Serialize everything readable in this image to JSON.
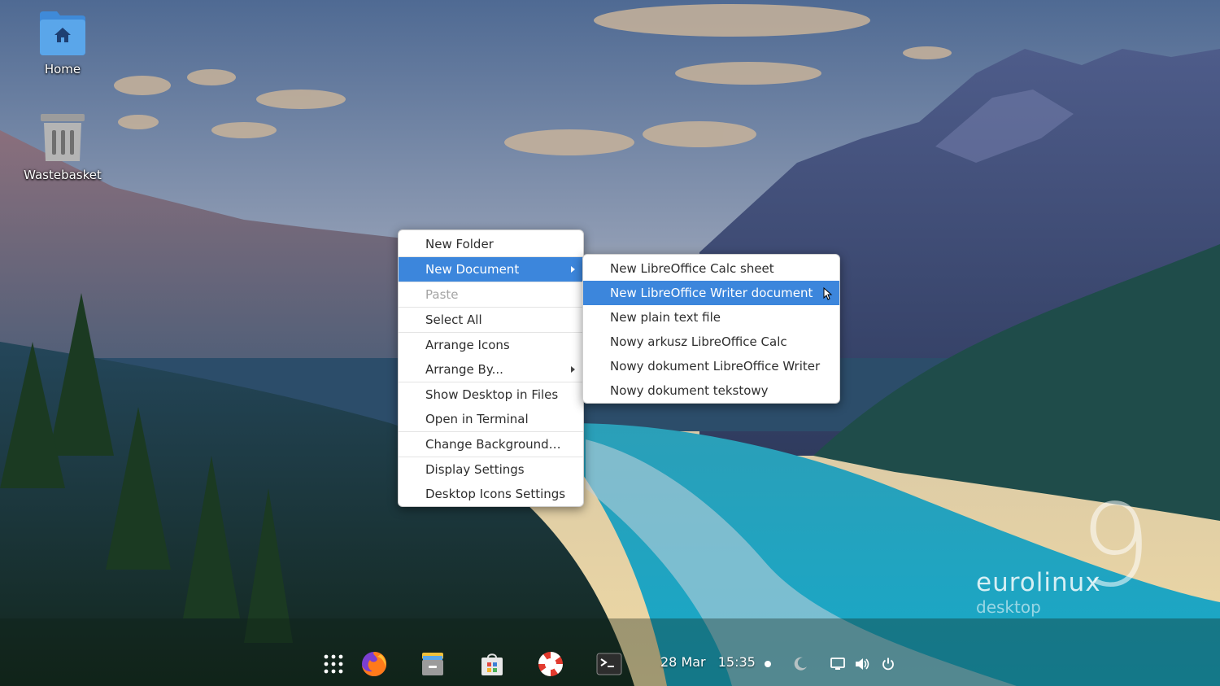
{
  "desktop": {
    "icons": [
      {
        "label": "Home",
        "icon": "home-folder-icon"
      },
      {
        "label": "Wastebasket",
        "icon": "trash-icon"
      }
    ]
  },
  "context_menu": {
    "items": [
      {
        "label": "New Folder"
      },
      {
        "label": "New Document",
        "highlighted": true,
        "submenu": true
      },
      {
        "label": "Paste",
        "disabled": true
      },
      {
        "label": "Select All"
      },
      {
        "label": "Arrange Icons"
      },
      {
        "label": "Arrange By...",
        "submenu": true
      },
      {
        "label": "Show Desktop in Files"
      },
      {
        "label": "Open in Terminal"
      },
      {
        "label": "Change Background…"
      },
      {
        "label": "Display Settings"
      },
      {
        "label": "Desktop Icons Settings"
      }
    ]
  },
  "submenu": {
    "items": [
      {
        "label": "New LibreOffice Calc sheet"
      },
      {
        "label": "New LibreOffice Writer document",
        "highlighted": true
      },
      {
        "label": "New plain text file"
      },
      {
        "label": "Nowy arkusz LibreOffice Calc"
      },
      {
        "label": "Nowy dokument LibreOffice Writer"
      },
      {
        "label": "Nowy dokument tekstowy"
      }
    ]
  },
  "watermark": {
    "number": "9",
    "name": "eurolinux",
    "sub": "desktop"
  },
  "taskbar": {
    "icons": [
      "app-grid-icon",
      "firefox-icon",
      "files-icon",
      "software-store-icon",
      "help-icon",
      "terminal-icon"
    ],
    "date": "28 Mar",
    "time": "15:35",
    "tray": [
      "notification-dot-icon",
      "night-light-icon",
      "screen-icon",
      "volume-icon",
      "power-icon"
    ]
  },
  "colors": {
    "highlight": "#3c86dc",
    "menu_bg": "#ffffff",
    "text": "#2e2e2e",
    "disabled_text": "#a4a4a4"
  }
}
